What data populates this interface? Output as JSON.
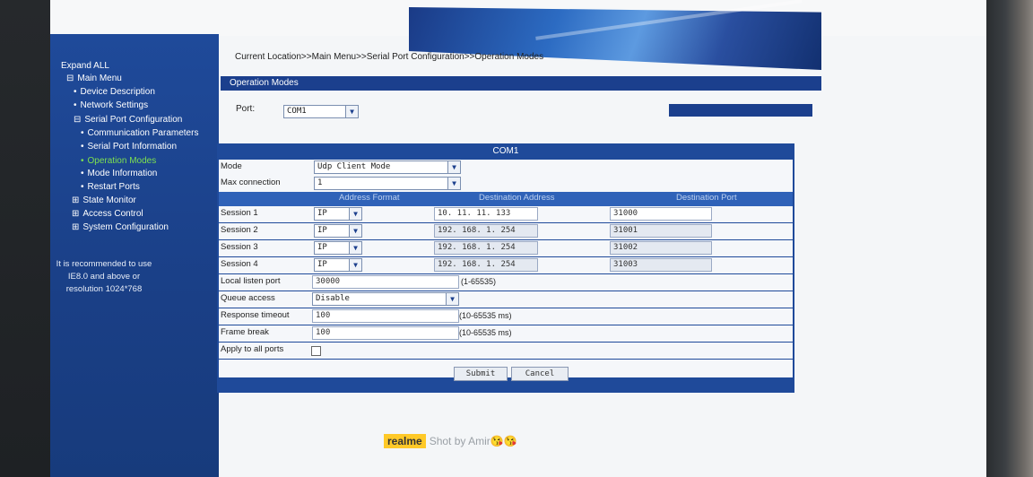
{
  "breadcrumb": "Current Location>>Main Menu>>Serial Port Configuration>>Operation Modes",
  "section_title": "Operation Modes",
  "port": {
    "label": "Port:",
    "value": "COM1"
  },
  "sidebar": {
    "expand_all": "Expand ALL",
    "items": [
      {
        "label": "Main Menu",
        "bullet": "⊟"
      },
      {
        "label": "Device Description",
        "bullet": "•"
      },
      {
        "label": "Network Settings",
        "bullet": "•"
      },
      {
        "label": "Serial Port Configuration",
        "bullet": "⊟"
      },
      {
        "label": "Communication Parameters",
        "bullet": "•"
      },
      {
        "label": "Serial Port Information",
        "bullet": "•"
      },
      {
        "label": "Operation Modes",
        "bullet": "•"
      },
      {
        "label": "Mode Information",
        "bullet": "•"
      },
      {
        "label": "Restart Ports",
        "bullet": "•"
      },
      {
        "label": "State Monitor",
        "bullet": "⊞"
      },
      {
        "label": "Access Control",
        "bullet": "⊞"
      },
      {
        "label": "System Configuration",
        "bullet": "⊞"
      }
    ],
    "note": "It is recommended to use IE8.0 and above or resolution 1024*768"
  },
  "panel": {
    "title": "COM1",
    "mode": {
      "label": "Mode",
      "value": "Udp Client Mode"
    },
    "max_connection": {
      "label": "Max connection",
      "value": "1"
    },
    "headers": {
      "address_format": "Address Format",
      "destination_address": "Destination Address",
      "destination_port": "Destination Port"
    },
    "sessions": [
      {
        "label": "Session 1",
        "format": "IP",
        "address": "10. 11. 11. 133",
        "port": "31000"
      },
      {
        "label": "Session 2",
        "format": "IP",
        "address": "192. 168. 1. 254",
        "port": "31001"
      },
      {
        "label": "Session 3",
        "format": "IP",
        "address": "192. 168. 1. 254",
        "port": "31002"
      },
      {
        "label": "Session 4",
        "format": "IP",
        "address": "192. 168. 1. 254",
        "port": "31003"
      }
    ],
    "local_listen_port": {
      "label": "Local listen port",
      "value": "30000",
      "hint": "(1-65535)"
    },
    "queue_access": {
      "label": "Queue access",
      "value": "Disable"
    },
    "response_timeout": {
      "label": "Response timeout",
      "value": "100",
      "hint": "(10-65535 ms)"
    },
    "frame_break": {
      "label": "Frame break",
      "value": "100",
      "hint": "(10-65535 ms)"
    },
    "apply_all": {
      "label": "Apply to all ports"
    },
    "submit_label": "Submit",
    "cancel_label": "Cancel"
  },
  "watermark": {
    "brand": "realme",
    "text": "Shot by Amir",
    "emoji": "😘😘"
  },
  "colors": {
    "sidebar": "#1f4a9a",
    "active_link": "#7de04f",
    "header_bar": "#1b3f8d"
  }
}
